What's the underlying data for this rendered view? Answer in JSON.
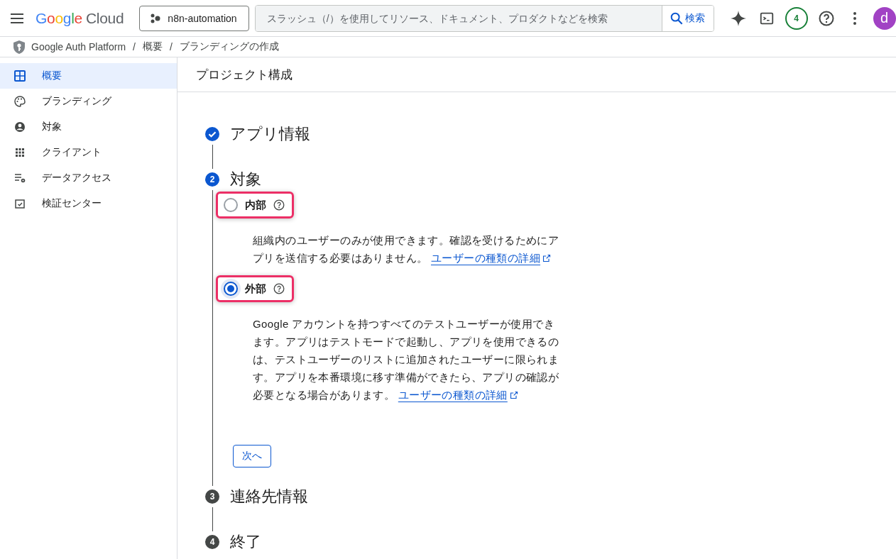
{
  "header": {
    "logo": {
      "brand": "Google",
      "product": "Cloud"
    },
    "project": "n8n-automation",
    "search": {
      "placeholder": "スラッシュ（/）を使用してリソース、ドキュメント、プロダクトなどを検索",
      "button": "検索"
    },
    "notifications": "4",
    "avatar": "d"
  },
  "breadcrumb": [
    {
      "kind": "link",
      "text": "Google Auth Platform"
    },
    {
      "kind": "separator",
      "text": "/"
    },
    {
      "kind": "link",
      "text": "概要"
    },
    {
      "kind": "separator",
      "text": "/"
    },
    {
      "kind": "link",
      "text": "ブランディングの作成"
    }
  ],
  "sidebar": {
    "items": [
      {
        "label": "概要",
        "selected": true
      },
      {
        "label": "ブランディング",
        "selected": false
      },
      {
        "label": "対象",
        "selected": false
      },
      {
        "label": "クライアント",
        "selected": false
      },
      {
        "label": "データアクセス",
        "selected": false
      },
      {
        "label": "検証センター",
        "selected": false
      }
    ]
  },
  "page_title": "プロジェクト構成",
  "steps": [
    {
      "kind": "done",
      "title": "アプリ情報"
    },
    {
      "kind": "active",
      "number": "2",
      "title": "対象",
      "options": [
        {
          "label": "内部",
          "selected": false,
          "highlighted": true,
          "description": "組織内のユーザーのみが使用できます。確認を受けるためにアプリを送信する必要はありません。",
          "link": "ユーザーの種類の詳細"
        },
        {
          "label": "外部",
          "selected": true,
          "highlighted": true,
          "description": "Google アカウントを持つすべてのテストユーザーが使用できます。アプリはテストモードで起動し、アプリを使用できるのは、テストユーザーのリストに追加されたユーザーに限られます。アプリを本番環境に移す準備ができたら、アプリの確認が必要となる場合があります。",
          "link": "ユーザーの種類の詳細"
        }
      ],
      "button": "次へ"
    },
    {
      "kind": "pending",
      "number": "3",
      "title": "連絡先情報"
    },
    {
      "kind": "pending",
      "number": "4",
      "title": "終了"
    }
  ]
}
